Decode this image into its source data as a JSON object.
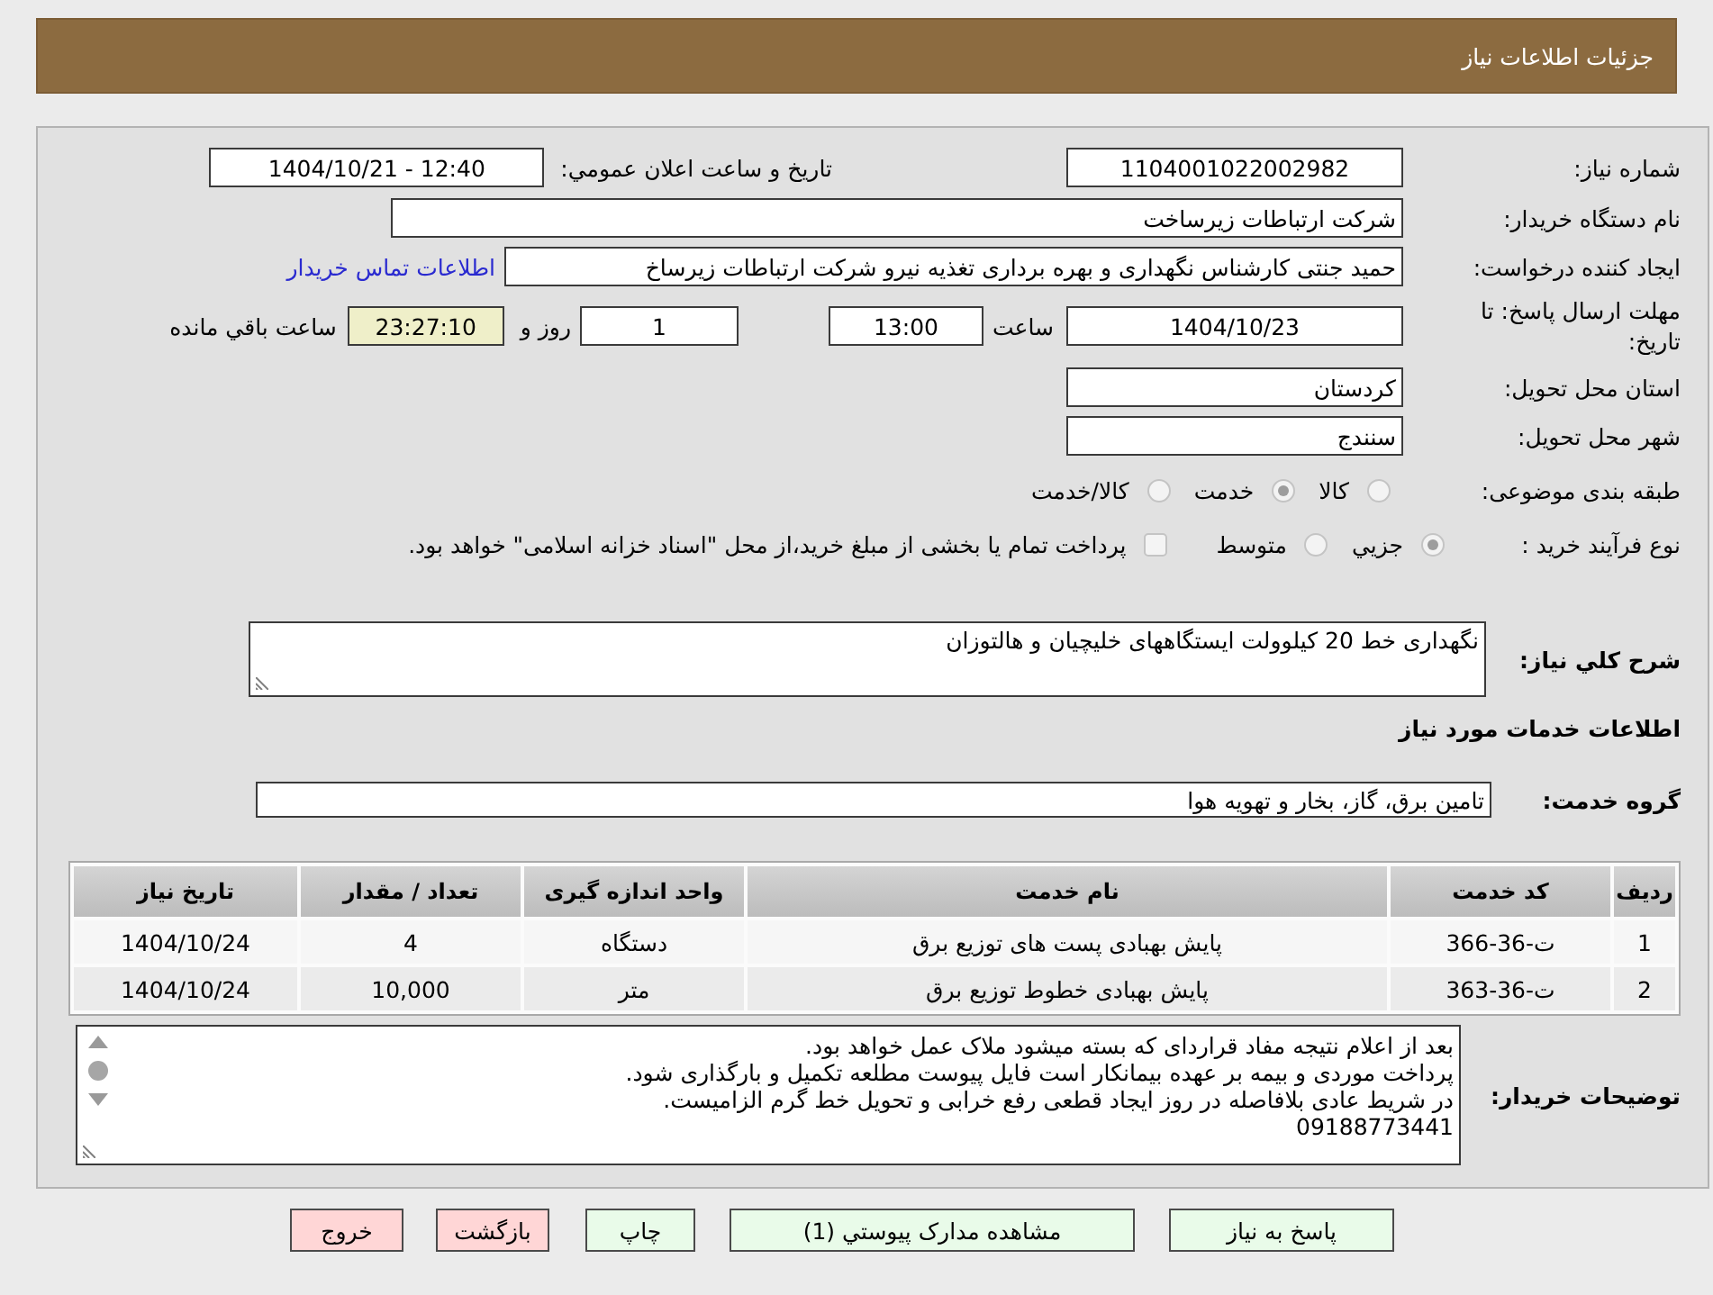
{
  "header": {
    "title": "جزئیات اطلاعات نیاز"
  },
  "need": {
    "number": {
      "label": "شماره نیاز:",
      "value": "1104001022002982"
    },
    "announcement": {
      "label": "تاریخ و ساعت اعلان عمومي:",
      "value": "1404/10/21 - 12:40"
    },
    "buyer": {
      "label": "نام دستگاه خریدار:",
      "value": "شرکت ارتباطات زیرساخت"
    },
    "requester": {
      "label": "ایجاد کننده درخواست:",
      "value": "حمید جنتی کارشناس نگهداری و بهره برداری تغذیه نیرو شرکت ارتباطات زیرساخ",
      "contact_link": "اطلاعات تماس خریدار"
    },
    "deadline": {
      "label": "مهلت ارسال پاسخ: تا تاریخ:",
      "date": "1404/10/23",
      "time_label": "ساعت",
      "time": "13:00",
      "days": "1",
      "days_label": "روز و",
      "remaining": "23:27:10",
      "remaining_label": "ساعت باقي مانده"
    },
    "province": {
      "label": "استان محل تحویل:",
      "value": "کردستان"
    },
    "city": {
      "label": "شهر محل تحویل:",
      "value": "سنندج"
    },
    "category": {
      "label": "طبقه بندی موضوعی:",
      "options": [
        {
          "label": "کالا",
          "selected": false
        },
        {
          "label": "خدمت",
          "selected": true
        },
        {
          "label": "کالا/خدمت",
          "selected": false
        }
      ]
    },
    "purchase_process": {
      "label": "نوع فرآیند خرید :",
      "options": [
        {
          "label": "جزيي",
          "selected": true
        },
        {
          "label": "متوسط",
          "selected": false
        }
      ],
      "treasury_payment": {
        "label": "پرداخت تمام یا بخشی از مبلغ خرید،از محل \"اسناد خزانه اسلامی\" خواهد بود.",
        "checked": false
      }
    },
    "description": {
      "label": "شرح کلي نیاز:",
      "value": "نگهداری خط 20 کیلوولت ایستگاههای خلیچیان و هالتوزان"
    }
  },
  "services": {
    "title": "اطلاعات خدمات مورد نیاز",
    "group": {
      "label": "گروه خدمت:",
      "value": "تامین برق، گاز، بخار و تهویه هوا"
    },
    "table": {
      "columns": [
        "ردیف",
        "کد خدمت",
        "نام خدمت",
        "واحد اندازه گیری",
        "تعداد / مقدار",
        "تاریخ نیاز"
      ],
      "rows": [
        [
          "1",
          "ت-36-366",
          "پایش بهبادی پست های توزیع برق",
          "دستگاه",
          "4",
          "1404/10/24"
        ],
        [
          "2",
          "ت-36-363",
          "پایش بهبادی خطوط توزیع برق",
          "متر",
          "10,000",
          "1404/10/24"
        ]
      ]
    }
  },
  "buyer_notes": {
    "label": "توضیحات خریدار:",
    "lines": [
      "بعد از اعلام نتیجه مفاد قراردای که بسته میشود ملاک عمل خواهد بود.",
      "پرداخت موردی و بیمه بر عهده بیمانکار است فایل پیوست  مطلعه تکمیل و بارگذاری شود.",
      "در شریط عادی بلافاصله در روز ایجاد قطعی رفع خرابی و تحویل خط گرم الزامیست.",
      "09188773441"
    ]
  },
  "buttons": [
    {
      "label": "پاسخ به نیاز",
      "color": "#e9fbe9"
    },
    {
      "label": "مشاهده مدارک پیوستي (1)",
      "color": "#e9fbe9"
    },
    {
      "label": "چاپ",
      "color": "#e9fbe9"
    },
    {
      "label": "بازگشت",
      "color": "#ffd6d6"
    },
    {
      "label": "خروج",
      "color": "#ffd6d6"
    }
  ]
}
